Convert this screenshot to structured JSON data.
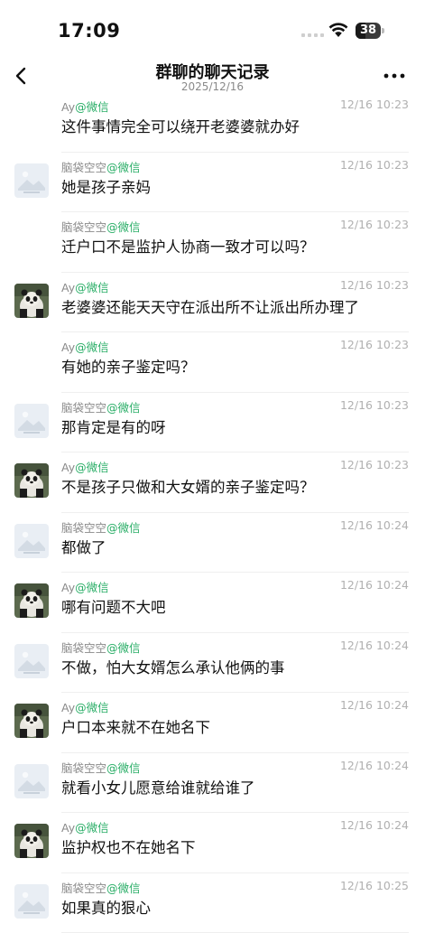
{
  "status_bar": {
    "time": "17:09",
    "battery": "38"
  },
  "nav": {
    "title": "群聊的聊天记录",
    "subtitle": "2025/12/16"
  },
  "messages": [
    {
      "sender": "Ay",
      "tag": "@微信",
      "avatar": "none",
      "time": "12/16 10:23",
      "text": "这件事情完全可以绕开老婆婆就办好"
    },
    {
      "sender": "脑袋空空",
      "tag": "@微信",
      "avatar": "placeholder",
      "time": "12/16 10:23",
      "text": "她是孩子亲妈"
    },
    {
      "sender": "脑袋空空",
      "tag": "@微信",
      "avatar": "none",
      "time": "12/16 10:23",
      "text": "迁户口不是监护人协商一致才可以吗？"
    },
    {
      "sender": "Ay",
      "tag": "@微信",
      "avatar": "panda",
      "time": "12/16 10:23",
      "text": "老婆婆还能天天守在派出所不让派出所办理了"
    },
    {
      "sender": "Ay",
      "tag": "@微信",
      "avatar": "none",
      "time": "12/16 10:23",
      "text": "有她的亲子鉴定吗？"
    },
    {
      "sender": "脑袋空空",
      "tag": "@微信",
      "avatar": "placeholder",
      "time": "12/16 10:23",
      "text": "那肯定是有的呀"
    },
    {
      "sender": "Ay",
      "tag": "@微信",
      "avatar": "panda",
      "time": "12/16 10:23",
      "text": "不是孩子只做和大女婿的亲子鉴定吗？"
    },
    {
      "sender": "脑袋空空",
      "tag": "@微信",
      "avatar": "placeholder",
      "time": "12/16 10:24",
      "text": "都做了"
    },
    {
      "sender": "Ay",
      "tag": "@微信",
      "avatar": "panda",
      "time": "12/16 10:24",
      "text": "哪有问题不大吧"
    },
    {
      "sender": "脑袋空空",
      "tag": "@微信",
      "avatar": "placeholder",
      "time": "12/16 10:24",
      "text": "不做，怕大女婿怎么承认他俩的事"
    },
    {
      "sender": "Ay",
      "tag": "@微信",
      "avatar": "panda",
      "time": "12/16 10:24",
      "text": "户口本来就不在她名下"
    },
    {
      "sender": "脑袋空空",
      "tag": "@微信",
      "avatar": "placeholder",
      "time": "12/16 10:24",
      "text": "就看小女儿愿意给谁就给谁了"
    },
    {
      "sender": "Ay",
      "tag": "@微信",
      "avatar": "panda",
      "time": "12/16 10:24",
      "text": "监护权也不在她名下"
    },
    {
      "sender": "脑袋空空",
      "tag": "@微信",
      "avatar": "placeholder",
      "time": "12/16 10:25",
      "text": "如果真的狠心"
    }
  ],
  "icons": {
    "back": "chevron-left-icon",
    "more": "more-dots-icon",
    "wifi": "wifi-icon",
    "placeholder_avatar": "image-placeholder-icon",
    "panda_avatar": "panda-avatar"
  },
  "colors": {
    "tag_green": "#2aae67",
    "meta_gray": "#8a8a8a",
    "time_gray": "#b0b0b0"
  }
}
